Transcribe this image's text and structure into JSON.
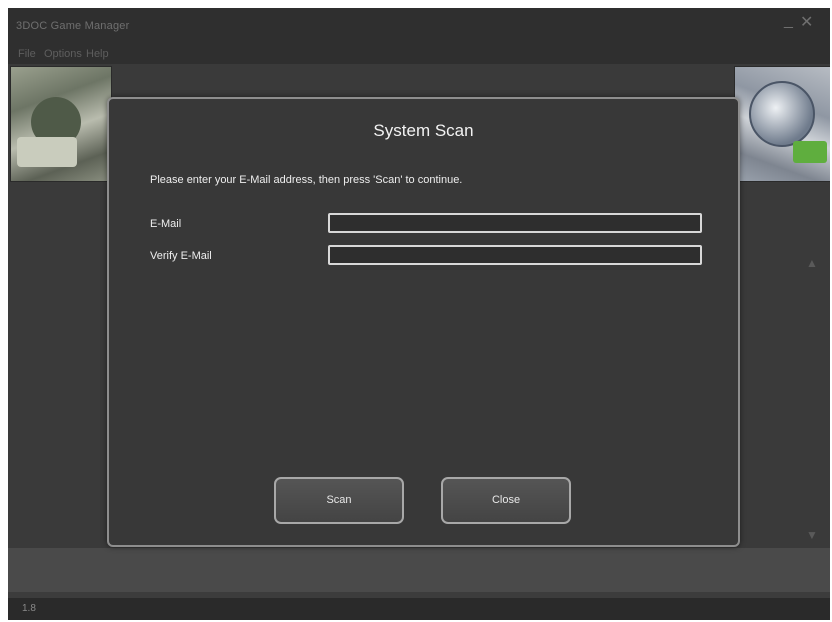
{
  "app": {
    "title": "3DOC Game Manager",
    "minimize_glyph": "_",
    "close_glyph": "✕",
    "version": "1.8"
  },
  "menu": {
    "items": [
      "File",
      "Options",
      "Help"
    ]
  },
  "dialog": {
    "title": "System Scan",
    "instruction": "Please enter your E-Mail address, then press 'Scan' to continue.",
    "email_label": "E-Mail",
    "email_value": "",
    "verify_label": "Verify E-Mail",
    "verify_value": "",
    "scan_label": "Scan",
    "close_label": "Close"
  },
  "scroll": {
    "up_glyph": "▲",
    "down_glyph": "▼"
  },
  "icons": [
    "minimize-icon",
    "close-icon",
    "scroll-up-icon",
    "scroll-down-icon"
  ],
  "colors": {
    "window_bg": "#3c3c3c",
    "dialog_bg": "#383838",
    "dialog_border": "#8e8e8e",
    "text": "#eeeeee"
  }
}
